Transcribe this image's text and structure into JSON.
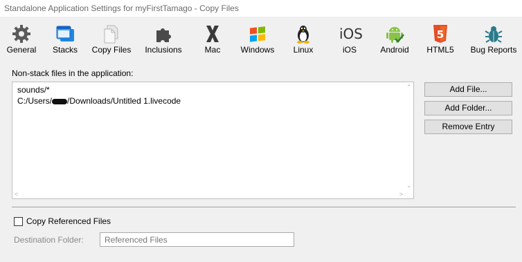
{
  "window": {
    "title": "Standalone Application Settings for myFirstTamago - Copy Files"
  },
  "toolbar": {
    "items": [
      {
        "label": "General",
        "icon": "gear-icon"
      },
      {
        "label": "Stacks",
        "icon": "stacks-icon"
      },
      {
        "label": "Copy Files",
        "icon": "copy-files-icon",
        "selected": true
      },
      {
        "label": "Inclusions",
        "icon": "puzzle-icon"
      },
      {
        "label": "Mac",
        "icon": "mac-x-icon"
      },
      {
        "label": "Windows",
        "icon": "windows-logo-icon"
      },
      {
        "label": "Linux",
        "icon": "linux-penguin-icon"
      },
      {
        "label": "iOS",
        "icon": "ios-text-icon"
      },
      {
        "label": "Android",
        "icon": "android-robot-icon"
      },
      {
        "label": "HTML5",
        "icon": "html5-shield-icon"
      },
      {
        "label": "Bug Reports",
        "icon": "bug-icon"
      }
    ],
    "ios_icon_text": "iOS",
    "html5_icon_text": "5"
  },
  "main": {
    "section_label": "Non-stack files in the application:",
    "files": [
      {
        "prefix": "sounds/*",
        "suffix": ""
      },
      {
        "prefix": "C:/Users/",
        "suffix": "/Downloads/Untitled 1.livecode"
      }
    ],
    "buttons": {
      "add_file": "Add File...",
      "add_folder": "Add Folder...",
      "remove_entry": "Remove Entry"
    },
    "copy_referenced_label": "Copy Referenced Files",
    "copy_referenced_checked": false,
    "destination_label": "Destination Folder:",
    "destination_placeholder": "Referenced Files"
  },
  "colors": {
    "window_bg": "#f0f0f0",
    "button_bg": "#e1e1e1",
    "html5_orange": "#e44d26",
    "android_green": "#8bc34a",
    "windows_red": "#f25022",
    "windows_green": "#7fba00",
    "windows_blue": "#00a4ef",
    "windows_yellow": "#ffb900"
  }
}
